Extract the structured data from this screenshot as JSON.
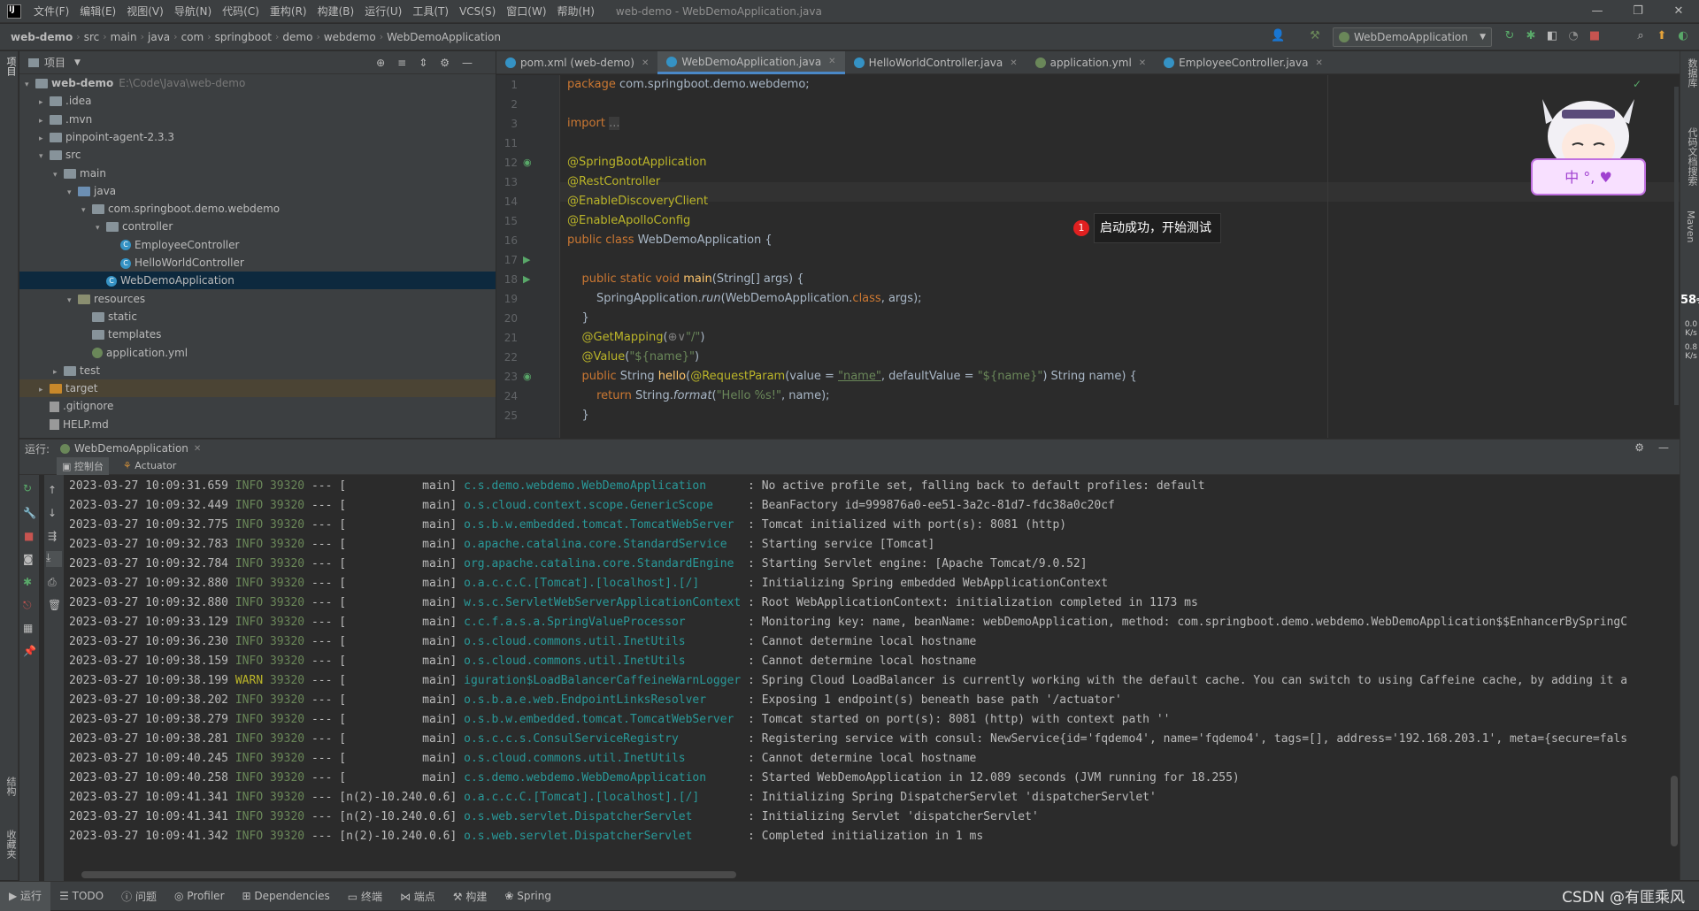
{
  "menubar": {
    "items": [
      "文件(F)",
      "编辑(E)",
      "视图(V)",
      "导航(N)",
      "代码(C)",
      "重构(R)",
      "构建(B)",
      "运行(U)",
      "工具(T)",
      "VCS(S)",
      "窗口(W)",
      "帮助(H)"
    ],
    "title": "web-demo - WebDemoApplication.java"
  },
  "breadcrumb": [
    "web-demo",
    "src",
    "main",
    "java",
    "com",
    "springboot",
    "demo",
    "webdemo",
    "WebDemoApplication"
  ],
  "toolbar": {
    "run_config": "WebDemoApplication"
  },
  "left_strip": {
    "project_label": "项目",
    "structure_label": "结构",
    "favorites_label": "收藏夹"
  },
  "right_strip": {
    "database_label": "数据库",
    "doc_label": "代码文档搜索",
    "maven_label": "Maven",
    "cpu_pct": "58",
    "cpu_unit": "%",
    "up_rate": "0.0",
    "down_rate": "0.8",
    "rate_unit": "K/s"
  },
  "project": {
    "title": "项目",
    "tree": [
      {
        "label": "web-demo",
        "path": "E:\\Code\\Java\\web-demo",
        "depth": 0,
        "kind": "root",
        "arrow": "▾"
      },
      {
        "label": ".idea",
        "depth": 1,
        "kind": "folder",
        "arrow": "▸"
      },
      {
        "label": ".mvn",
        "depth": 1,
        "kind": "folder",
        "arrow": "▸"
      },
      {
        "label": "pinpoint-agent-2.3.3",
        "depth": 1,
        "kind": "folder",
        "arrow": "▸"
      },
      {
        "label": "src",
        "depth": 1,
        "kind": "folder",
        "arrow": "▾"
      },
      {
        "label": "main",
        "depth": 2,
        "kind": "folder",
        "arrow": "▾"
      },
      {
        "label": "java",
        "depth": 3,
        "kind": "folder-blue",
        "arrow": "▾"
      },
      {
        "label": "com.springboot.demo.webdemo",
        "depth": 4,
        "kind": "folder",
        "arrow": "▾"
      },
      {
        "label": "controller",
        "depth": 5,
        "kind": "folder",
        "arrow": "▾"
      },
      {
        "label": "EmployeeController",
        "depth": 6,
        "kind": "class",
        "arrow": ""
      },
      {
        "label": "HelloWorldController",
        "depth": 6,
        "kind": "class",
        "arrow": ""
      },
      {
        "label": "WebDemoApplication",
        "depth": 5,
        "kind": "class",
        "arrow": "",
        "selected": true
      },
      {
        "label": "resources",
        "depth": 3,
        "kind": "folder-res",
        "arrow": "▾"
      },
      {
        "label": "static",
        "depth": 4,
        "kind": "folder",
        "arrow": ""
      },
      {
        "label": "templates",
        "depth": 4,
        "kind": "folder",
        "arrow": ""
      },
      {
        "label": "application.yml",
        "depth": 4,
        "kind": "yml",
        "arrow": ""
      },
      {
        "label": "test",
        "depth": 2,
        "kind": "folder",
        "arrow": "▸"
      },
      {
        "label": "target",
        "depth": 1,
        "kind": "folder-tgt",
        "arrow": "▸",
        "target": true
      },
      {
        "label": ".gitignore",
        "depth": 1,
        "kind": "file",
        "arrow": ""
      },
      {
        "label": "HELP.md",
        "depth": 1,
        "kind": "file",
        "arrow": ""
      }
    ]
  },
  "editor": {
    "tabs": [
      {
        "label": "pom.xml (web-demo)",
        "icon": "m"
      },
      {
        "label": "WebDemoApplication.java",
        "icon": "c",
        "active": true
      },
      {
        "label": "HelloWorldController.java",
        "icon": "c"
      },
      {
        "label": "application.yml",
        "icon": "y"
      },
      {
        "label": "EmployeeController.java",
        "icon": "c"
      }
    ],
    "line_numbers": [
      "1",
      "2",
      "3",
      "11",
      "12",
      "13",
      "14",
      "15",
      "16",
      "17",
      "18",
      "19",
      "20",
      "21",
      "22",
      "23",
      "24",
      "25"
    ],
    "tooltip_badge": "1",
    "tooltip_text": "启动成功，开始测试",
    "mascot_text": "中 °, ♥"
  },
  "run": {
    "label": "运行:",
    "config": "WebDemoApplication",
    "tab_console": "控制台",
    "tab_actuator": "Actuator",
    "log": [
      {
        "ts": "2023-03-27 10:09:31.659",
        "lvl": "INFO",
        "pid": "39320",
        "thread": "main",
        "cls": "c.s.demo.webdemo.WebDemoApplication",
        "msg": "No active profile set, falling back to default profiles: default"
      },
      {
        "ts": "2023-03-27 10:09:32.449",
        "lvl": "INFO",
        "pid": "39320",
        "thread": "main",
        "cls": "o.s.cloud.context.scope.GenericScope",
        "msg": "BeanFactory id=999876a0-ee51-3a2c-81d7-fdc38a0c20cf"
      },
      {
        "ts": "2023-03-27 10:09:32.775",
        "lvl": "INFO",
        "pid": "39320",
        "thread": "main",
        "cls": "o.s.b.w.embedded.tomcat.TomcatWebServer",
        "msg": "Tomcat initialized with port(s): 8081 (http)"
      },
      {
        "ts": "2023-03-27 10:09:32.783",
        "lvl": "INFO",
        "pid": "39320",
        "thread": "main",
        "cls": "o.apache.catalina.core.StandardService",
        "msg": "Starting service [Tomcat]"
      },
      {
        "ts": "2023-03-27 10:09:32.784",
        "lvl": "INFO",
        "pid": "39320",
        "thread": "main",
        "cls": "org.apache.catalina.core.StandardEngine",
        "msg": "Starting Servlet engine: [Apache Tomcat/9.0.52]"
      },
      {
        "ts": "2023-03-27 10:09:32.880",
        "lvl": "INFO",
        "pid": "39320",
        "thread": "main",
        "cls": "o.a.c.c.C.[Tomcat].[localhost].[/]",
        "msg": "Initializing Spring embedded WebApplicationContext"
      },
      {
        "ts": "2023-03-27 10:09:32.880",
        "lvl": "INFO",
        "pid": "39320",
        "thread": "main",
        "cls": "w.s.c.ServletWebServerApplicationContext",
        "msg": "Root WebApplicationContext: initialization completed in 1173 ms"
      },
      {
        "ts": "2023-03-27 10:09:33.129",
        "lvl": "INFO",
        "pid": "39320",
        "thread": "main",
        "cls": "c.c.f.a.s.a.SpringValueProcessor",
        "msg": "Monitoring key: name, beanName: webDemoApplication, method: com.springboot.demo.webdemo.WebDemoApplication$$EnhancerBySpringC"
      },
      {
        "ts": "2023-03-27 10:09:36.230",
        "lvl": "INFO",
        "pid": "39320",
        "thread": "main",
        "cls": "o.s.cloud.commons.util.InetUtils",
        "msg": "Cannot determine local hostname"
      },
      {
        "ts": "2023-03-27 10:09:38.159",
        "lvl": "INFO",
        "pid": "39320",
        "thread": "main",
        "cls": "o.s.cloud.commons.util.InetUtils",
        "msg": "Cannot determine local hostname"
      },
      {
        "ts": "2023-03-27 10:09:38.199",
        "lvl": "WARN",
        "pid": "39320",
        "thread": "main",
        "cls": "iguration$LoadBalancerCaffeineWarnLogger",
        "msg": "Spring Cloud LoadBalancer is currently working with the default cache. You can switch to using Caffeine cache, by adding it a"
      },
      {
        "ts": "2023-03-27 10:09:38.202",
        "lvl": "INFO",
        "pid": "39320",
        "thread": "main",
        "cls": "o.s.b.a.e.web.EndpointLinksResolver",
        "msg": "Exposing 1 endpoint(s) beneath base path '/actuator'"
      },
      {
        "ts": "2023-03-27 10:09:38.279",
        "lvl": "INFO",
        "pid": "39320",
        "thread": "main",
        "cls": "o.s.b.w.embedded.tomcat.TomcatWebServer",
        "msg": "Tomcat started on port(s): 8081 (http) with context path ''"
      },
      {
        "ts": "2023-03-27 10:09:38.281",
        "lvl": "INFO",
        "pid": "39320",
        "thread": "main",
        "cls": "o.s.c.c.s.ConsulServiceRegistry",
        "msg": "Registering service with consul: NewService{id='fqdemo4', name='fqdemo4', tags=[], address='192.168.203.1', meta={secure=fals"
      },
      {
        "ts": "2023-03-27 10:09:40.245",
        "lvl": "INFO",
        "pid": "39320",
        "thread": "main",
        "cls": "o.s.cloud.commons.util.InetUtils",
        "msg": "Cannot determine local hostname"
      },
      {
        "ts": "2023-03-27 10:09:40.258",
        "lvl": "INFO",
        "pid": "39320",
        "thread": "main",
        "cls": "c.s.demo.webdemo.WebDemoApplication",
        "msg": "Started WebDemoApplication in 12.089 seconds (JVM running for 18.255)"
      },
      {
        "ts": "2023-03-27 10:09:41.341",
        "lvl": "INFO",
        "pid": "39320",
        "thread": "n(2)-10.240.0.6",
        "cls": "o.a.c.c.C.[Tomcat].[localhost].[/]",
        "msg": "Initializing Spring DispatcherServlet 'dispatcherServlet'"
      },
      {
        "ts": "2023-03-27 10:09:41.341",
        "lvl": "INFO",
        "pid": "39320",
        "thread": "n(2)-10.240.0.6",
        "cls": "o.s.web.servlet.DispatcherServlet",
        "msg": "Initializing Servlet 'dispatcherServlet'"
      },
      {
        "ts": "2023-03-27 10:09:41.342",
        "lvl": "INFO",
        "pid": "39320",
        "thread": "n(2)-10.240.0.6",
        "cls": "o.s.web.servlet.DispatcherServlet",
        "msg": "Completed initialization in 1 ms"
      }
    ]
  },
  "statusbar": {
    "items": [
      "运行",
      "TODO",
      "问题",
      "Profiler",
      "Dependencies",
      "终端",
      "端点",
      "构建",
      "Spring"
    ],
    "watermark": "CSDN @有匪乘风"
  },
  "colors": {
    "accent": "#4a88c7",
    "keyword": "#cc7832",
    "annotation": "#bbb529",
    "string": "#6a8759",
    "method": "#ffc66d"
  }
}
